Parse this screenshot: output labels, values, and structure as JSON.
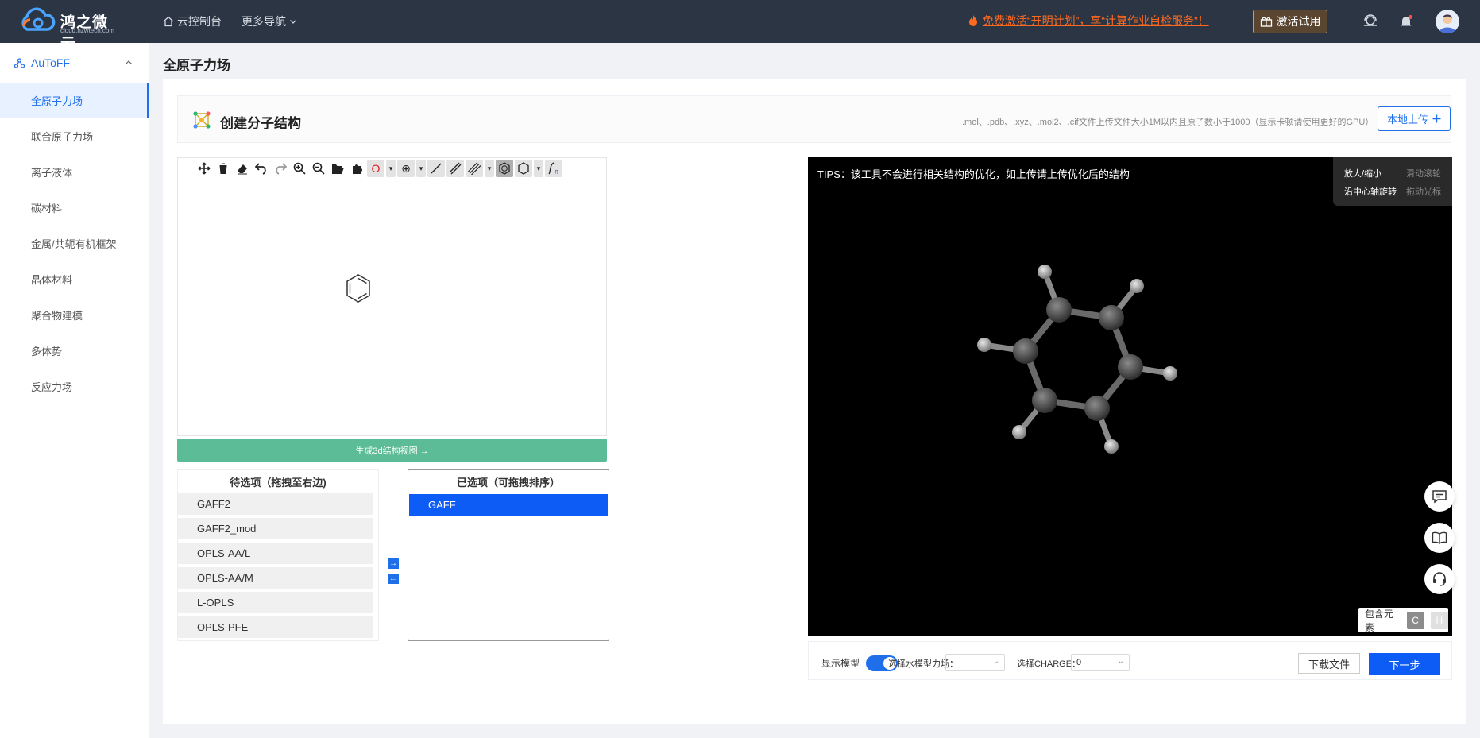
{
  "app": {
    "brand_name": "鸿之微云",
    "brand_sub": "cloud.hzwtech.com",
    "console_label": "云控制台",
    "more_nav_label": "更多导航",
    "promo_text": "免费激活“开明计划”，享“计算作业自检服务”！",
    "trial_label": "激活试用"
  },
  "sidebar": {
    "group_label": "AuToFF",
    "items": [
      {
        "label": "全原子力场",
        "active": true
      },
      {
        "label": "联合原子力场"
      },
      {
        "label": "离子液体"
      },
      {
        "label": "碳材料"
      },
      {
        "label": "金属/共轭有机框架"
      },
      {
        "label": "晶体材料"
      },
      {
        "label": "聚合物建模"
      },
      {
        "label": "多体势"
      },
      {
        "label": "反应力场"
      }
    ]
  },
  "page": {
    "title": "全原子力场",
    "card_title": "创建分子结构",
    "upload_hint": ".mol、.pdb、.xyz、.mol2、.cif文件上传文件大小1M以内且原子数小于1000（显示卡顿请使用更好的GPU）",
    "upload_label": "本地上传"
  },
  "editor": {
    "tools": [
      "move-icon",
      "trash-icon",
      "eraser-icon",
      "undo-icon",
      "redo-icon",
      "zoom-in-icon",
      "zoom-out-icon",
      "open-file-icon",
      "template-icon",
      "atom-o-icon",
      "charge-icon",
      "single-bond-icon",
      "double-bond-icon",
      "triple-bond-icon",
      "benzene-ring-icon",
      "cyclohexane-icon",
      "sgroup-icon"
    ],
    "atom_symbol": "O",
    "generate_label": "生成3d结构视图 →"
  },
  "lists": {
    "left_title": "待选项（拖拽至右边)",
    "right_title": "已选项（可拖拽排序）",
    "available": [
      "GAFF2",
      "GAFF2_mod",
      "OPLS-AA/L",
      "OPLS-AA/M",
      "L-OPLS",
      "OPLS-PFE"
    ],
    "selected": [
      "GAFF"
    ]
  },
  "viewer": {
    "tips": "TIPS：该工具不会进行相关结构的优化，如上传请上传优化后的结构",
    "legend": [
      {
        "key": "放大/缩小",
        "value": "滑动滚轮"
      },
      {
        "key": "沿中心轴旋转",
        "value": "拖动光标"
      }
    ],
    "elements_label": "包含元素",
    "elements": [
      "C",
      "H"
    ]
  },
  "controls": {
    "show_model_label": "显示模型",
    "show_model_on": true,
    "water_model_label": "选择水模型力场：",
    "water_model_value": "-",
    "charge_label": "选择CHARGE：",
    "charge_value": "0",
    "download_label": "下载文件",
    "next_label": "下一步"
  },
  "colors": {
    "accent": "#1f6feb",
    "primary_button": "#0d5cf5",
    "generate_button": "#5cbc97",
    "promo": "#ff6a1f",
    "topbar": "#2b3544"
  }
}
